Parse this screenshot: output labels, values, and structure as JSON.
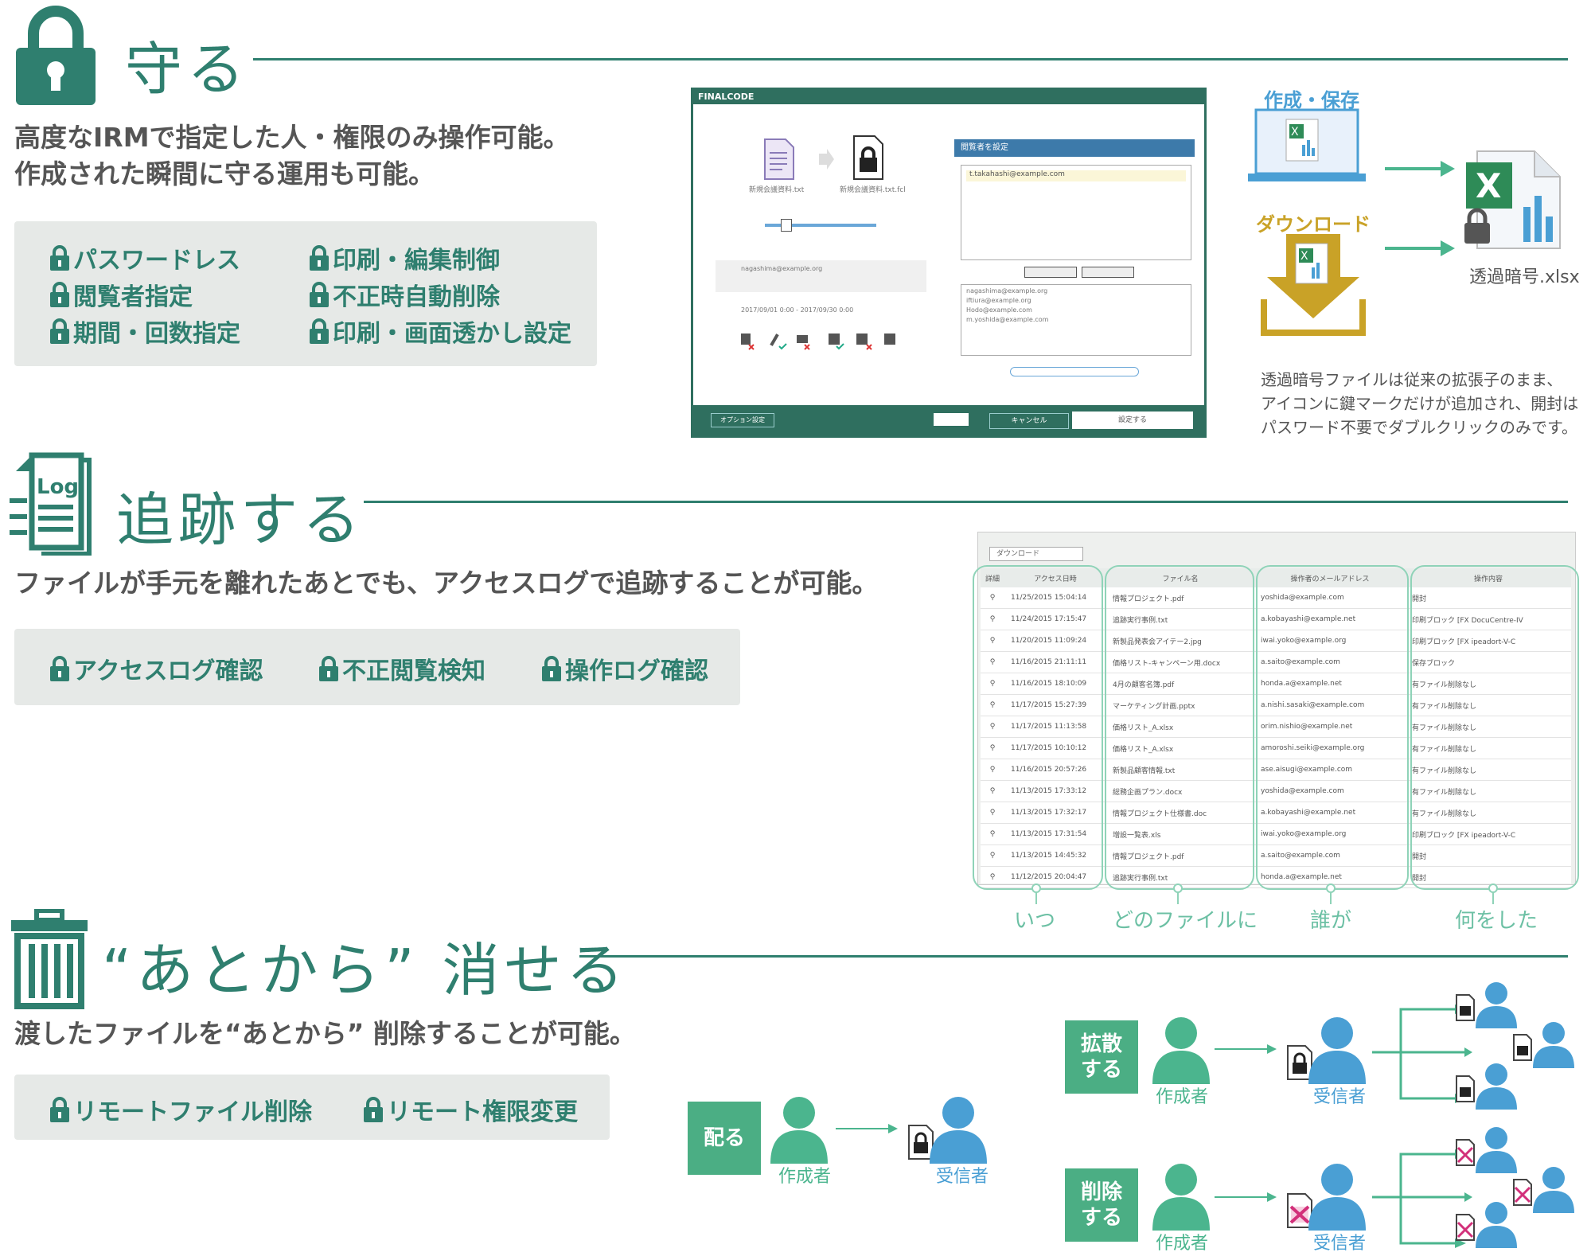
{
  "colors": {
    "accent": "#2f7f6f",
    "light_accent": "#6cc0a4",
    "box_bg": "#e6e9e7",
    "gold": "#c9a227",
    "person_green": "#4bb58e",
    "person_blue": "#4a9fd4"
  },
  "protect": {
    "icon": "padlock-icon",
    "title": "守る",
    "lead_line1": "高度なIRMで指定した人・権限のみ操作可能。",
    "lead_line2": "作成された瞬間に守る運用も可能。",
    "features": [
      "パスワードレス",
      "印刷・編集制御",
      "閲覧者指定",
      "不正時自動削除",
      "期間・回数指定",
      "印刷・画面透かし設定"
    ],
    "app": {
      "logo": "FINALCODE",
      "dialog_title": "閲覧者を設定",
      "email_input": "t.takahashi@example.com",
      "emails": [
        "nagashima@example.org",
        "iftiura@example.org",
        "Hodo@example.com",
        "m.yoshida@example.com"
      ],
      "option_button": "オプション設定",
      "cancel_button": "キャンセル",
      "ok_button": "設定する",
      "file_left": "新規会議資料.txt",
      "file_right": "新規会議資料.txt.fcl",
      "date_range": "2017/09/01 0:00 - 2017/09/30 0:00"
    },
    "flow": {
      "create_save": "作成・保存",
      "download": "ダウンロード",
      "output_file": "透過暗号.xlsx",
      "desc_line1": "透過暗号ファイルは従来の拡張子のまま、",
      "desc_line2": "アイコンに鍵マークだけが追加され、開封は",
      "desc_line3": "パスワード不要でダブルクリックのみです。"
    }
  },
  "track": {
    "icon": "log-document-icon",
    "icon_label": "Log",
    "title": "追跡する",
    "lead": "ファイルが手元を離れたあとでも、アクセスログで追跡することが可能。",
    "features": [
      "アクセスログ確認",
      "不正閲覧検知",
      "操作ログ確認"
    ],
    "log_table": {
      "toolbar_button": "ダウンロード",
      "columns": [
        "詳細",
        "アクセス日時",
        "ファイル名",
        "操作者のメールアドレス",
        "操作内容"
      ],
      "rows": [
        [
          "11/25/2015 15:04:14",
          "情報プロジェクト.pdf",
          "yoshida@example.com",
          "開封"
        ],
        [
          "11/24/2015 17:15:47",
          "追跡実行事例.txt",
          "a.kobayashi@example.net",
          "印刷ブロック [FX DocuCentre-IV"
        ],
        [
          "11/20/2015 11:09:24",
          "新製品発表会アイテー2.jpg",
          "iwai.yoko@example.org",
          "印刷ブロック [FX ipeadort-V-C"
        ],
        [
          "11/16/2015 21:11:11",
          "価格リスト-キャンペーン用.docx",
          "a.saito@example.com",
          "保存ブロック"
        ],
        [
          "11/16/2015 18:10:09",
          "4月の顧客名簿.pdf",
          "honda.a@example.net",
          "有ファイル削除なし"
        ],
        [
          "11/17/2015 15:27:39",
          "マーケティング計画.pptx",
          "a.nishi.sasaki@example.com",
          "有ファイル削除なし"
        ],
        [
          "11/17/2015 11:13:58",
          "価格リスト_A.xlsx",
          "orim.nishio@example.net",
          "有ファイル削除なし"
        ],
        [
          "11/17/2015 10:10:12",
          "価格リスト_A.xlsx",
          "amoroshi.seiki@example.org",
          "有ファイル削除なし"
        ],
        [
          "11/16/2015 20:57:26",
          "新製品顧客情報.txt",
          "ase.aisugi@example.com",
          "有ファイル削除なし"
        ],
        [
          "11/13/2015 17:33:12",
          "総務企画プラン.docx",
          "yoshida@example.com",
          "有ファイル削除なし"
        ],
        [
          "11/13/2015 17:32:17",
          "情報プロジェクト仕様書.doc",
          "a.kobayashi@example.net",
          "有ファイル削除なし"
        ],
        [
          "11/13/2015 17:31:54",
          "増設一覧表.xls",
          "iwai.yoko@example.org",
          "印刷ブロック [FX ipeadort-V-C"
        ],
        [
          "11/13/2015 14:45:32",
          "情報プロジェクト.pdf",
          "a.saito@example.com",
          "開封"
        ],
        [
          "11/12/2015 20:04:47",
          "追跡実行事例.txt",
          "honda.a@example.net",
          "開封"
        ]
      ],
      "captions": [
        "いつ",
        "どのファイルに",
        "誰が",
        "何をした"
      ]
    }
  },
  "erase": {
    "icon": "trash-can-icon",
    "title": "“あとから” 消せる",
    "lead": "渡したファイルを“あとから” 削除することが可能。",
    "features": [
      "リモートファイル削除",
      "リモート権限変更"
    ],
    "distribute": {
      "tag": "配る",
      "creator": "作成者",
      "receiver": "受信者"
    },
    "spread": {
      "tag_line1": "拡散",
      "tag_line2": "する",
      "creator": "作成者",
      "receiver": "受信者"
    },
    "delete": {
      "tag_line1": "削除",
      "tag_line2": "する",
      "creator": "作成者",
      "receiver": "受信者"
    }
  }
}
